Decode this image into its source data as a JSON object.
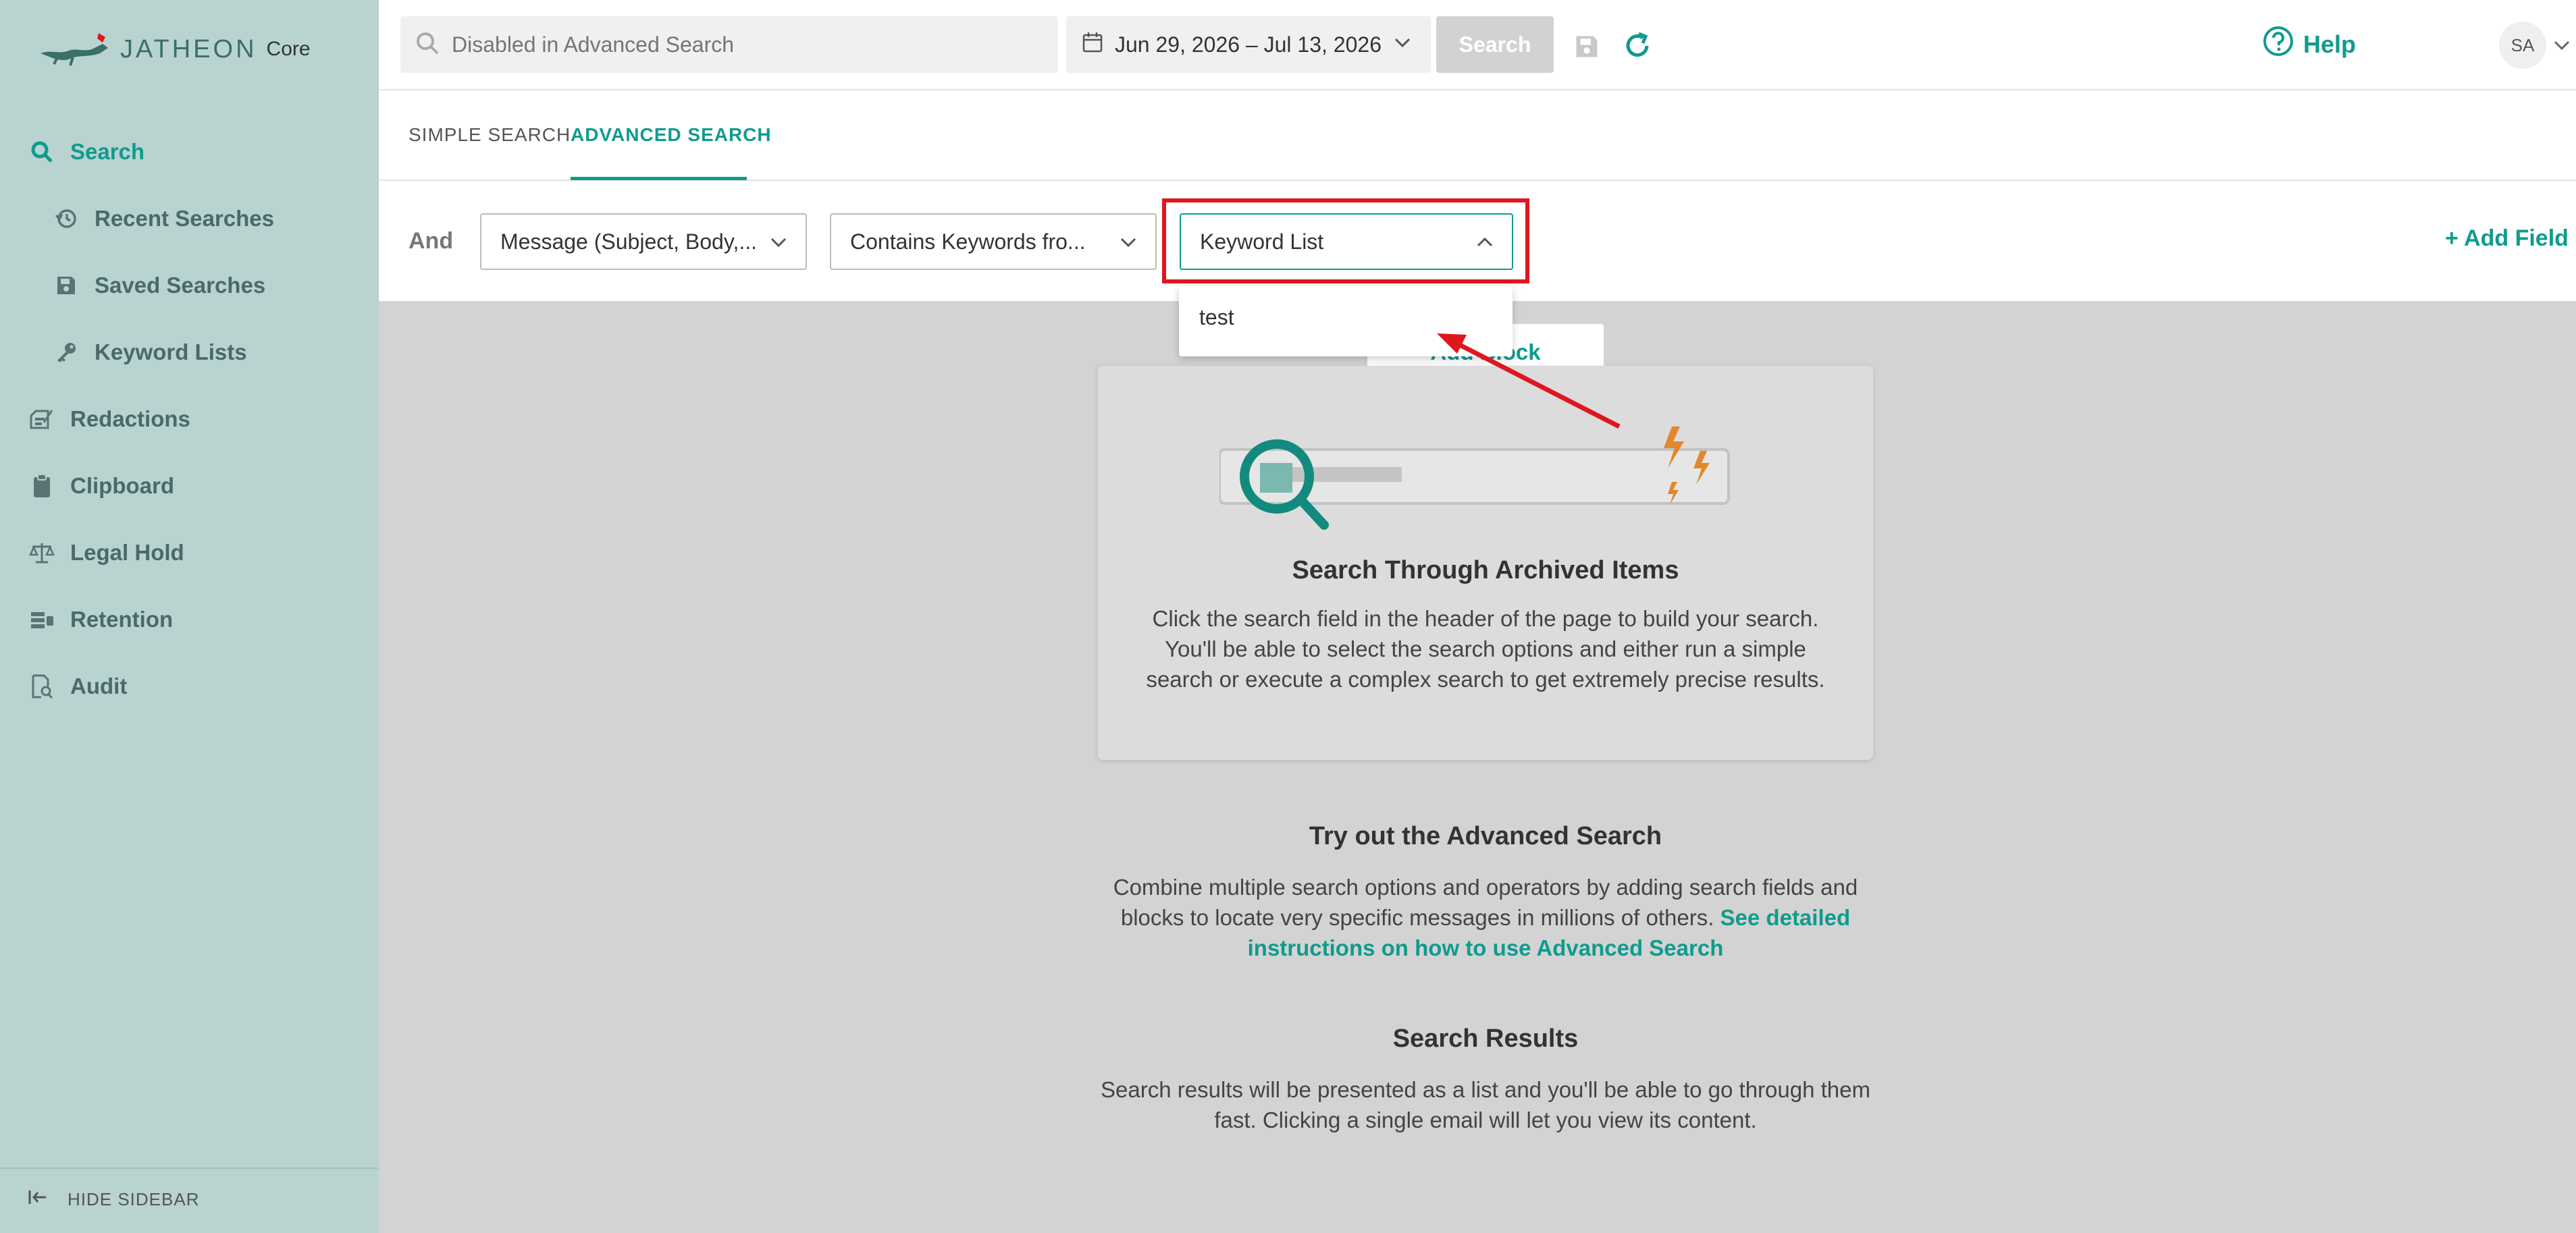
{
  "brand": {
    "name": "JATHEON",
    "product": "Core"
  },
  "sidebar": {
    "items": [
      {
        "label": "Search",
        "icon": "search-icon",
        "active": true
      },
      {
        "label": "Recent Searches",
        "icon": "history-icon"
      },
      {
        "label": "Saved Searches",
        "icon": "save-icon"
      },
      {
        "label": "Keyword Lists",
        "icon": "key-icon"
      },
      {
        "label": "Redactions",
        "icon": "redaction-icon"
      },
      {
        "label": "Clipboard",
        "icon": "clipboard-icon"
      },
      {
        "label": "Legal Hold",
        "icon": "scale-icon"
      },
      {
        "label": "Retention",
        "icon": "retention-icon"
      },
      {
        "label": "Audit",
        "icon": "audit-icon"
      }
    ],
    "hide_label": "HIDE SIDEBAR"
  },
  "header": {
    "search_placeholder": "Disabled in Advanced Search",
    "date_range": "Jun 29, 2026 – Jul 13, 2026",
    "search_button": "Search",
    "help": "Help",
    "avatar": "SA"
  },
  "tabs": [
    {
      "label": "SIMPLE SEARCH"
    },
    {
      "label": "ADVANCED SEARCH",
      "active": true
    }
  ],
  "builder": {
    "operator": "And",
    "field": "Message (Subject, Body,...",
    "condition": "Contains Keywords fro...",
    "value": "Keyword List",
    "add_field": "+ Add Field"
  },
  "dropdown": {
    "options": [
      "test"
    ]
  },
  "main": {
    "add_block": "Add Block",
    "card_title": "Search Through Archived Items",
    "card_text": "Click the search field in the header of the page to build your search. You'll be able to select the search options and either run a simple search or execute a complex search to get extremely precise results.",
    "adv_title": "Try out the Advanced Search",
    "adv_text": "Combine multiple search options and operators by adding search fields and blocks to locate very specific messages in millions of others.",
    "adv_link": "See detailed instructions on how to use Advanced Search",
    "results_title": "Search Results",
    "results_text": "Search results will be presented as a list and you'll be able to go through them fast. Clicking a single email will let you view its content."
  },
  "colors": {
    "accent": "#0f9b8e",
    "sidebar_bg": "#b8d3d0",
    "highlight": "#e0161e",
    "bolt": "#e2872c"
  }
}
